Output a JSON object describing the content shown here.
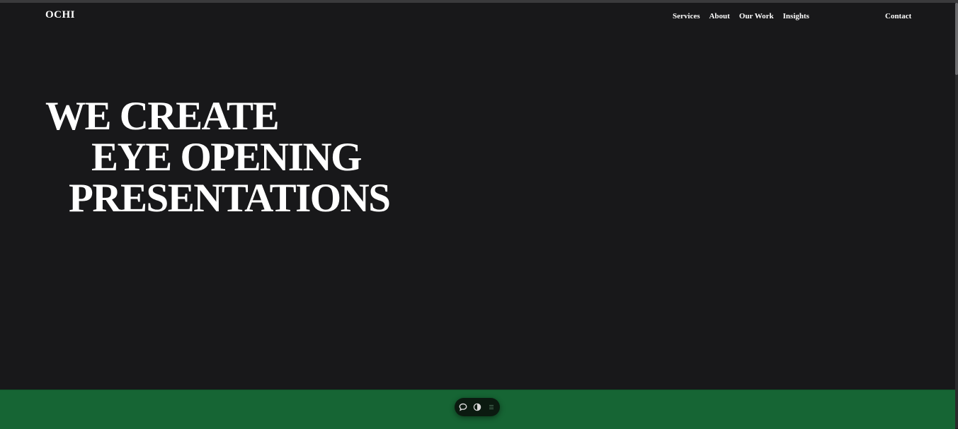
{
  "header": {
    "logo": "OCHI",
    "nav": [
      "Services",
      "About",
      "Our Work",
      "Insights"
    ],
    "contact": "Contact"
  },
  "hero": {
    "lines": [
      "WE CREATE",
      "EYE OPENING",
      "PRESENTATIONS"
    ]
  },
  "toolbar": {
    "icons": [
      "chat-icon",
      "theme-toggle-icon",
      "menu-icon"
    ]
  },
  "colors": {
    "background": "#18181a",
    "band": "#166534",
    "text": "#ffffff"
  }
}
